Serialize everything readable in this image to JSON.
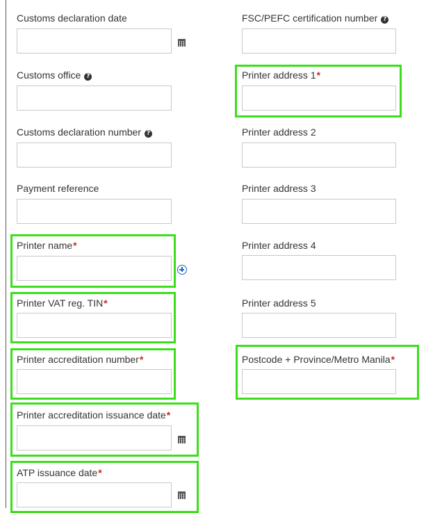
{
  "left_column": {
    "customs_declaration_date": {
      "label": "Customs declaration date",
      "value": ""
    },
    "customs_office": {
      "label": "Customs office",
      "value": ""
    },
    "customs_declaration_number": {
      "label": "Customs declaration number",
      "value": ""
    },
    "payment_reference": {
      "label": "Payment reference",
      "value": ""
    },
    "printer_name": {
      "label": "Printer name",
      "value": ""
    },
    "printer_vat": {
      "label": "Printer VAT reg. TIN",
      "value": ""
    },
    "printer_accreditation_number": {
      "label": "Printer accreditation number",
      "value": ""
    },
    "printer_accreditation_issuance_date": {
      "label": "Printer accreditation issuance date",
      "value": ""
    },
    "atp_issuance_date": {
      "label": "ATP issuance date",
      "value": ""
    }
  },
  "right_column": {
    "fsc_pefc": {
      "label": "FSC/PEFC certification number",
      "value": ""
    },
    "printer_address_1": {
      "label": "Printer address 1",
      "value": ""
    },
    "printer_address_2": {
      "label": "Printer address 2",
      "value": ""
    },
    "printer_address_3": {
      "label": "Printer address 3",
      "value": ""
    },
    "printer_address_4": {
      "label": "Printer address 4",
      "value": ""
    },
    "printer_address_5": {
      "label": "Printer address 5",
      "value": ""
    },
    "postcode_province": {
      "label": "Postcode + Province/Metro Manila",
      "value": ""
    }
  },
  "required_marker": "*",
  "help_glyph": "?",
  "icons": {
    "calendar": "calendar-icon",
    "help": "help-icon",
    "add": "add-circle-icon"
  },
  "colors": {
    "highlight": "#3adf1a",
    "required": "#c62828",
    "add_icon": "#1565c0"
  }
}
